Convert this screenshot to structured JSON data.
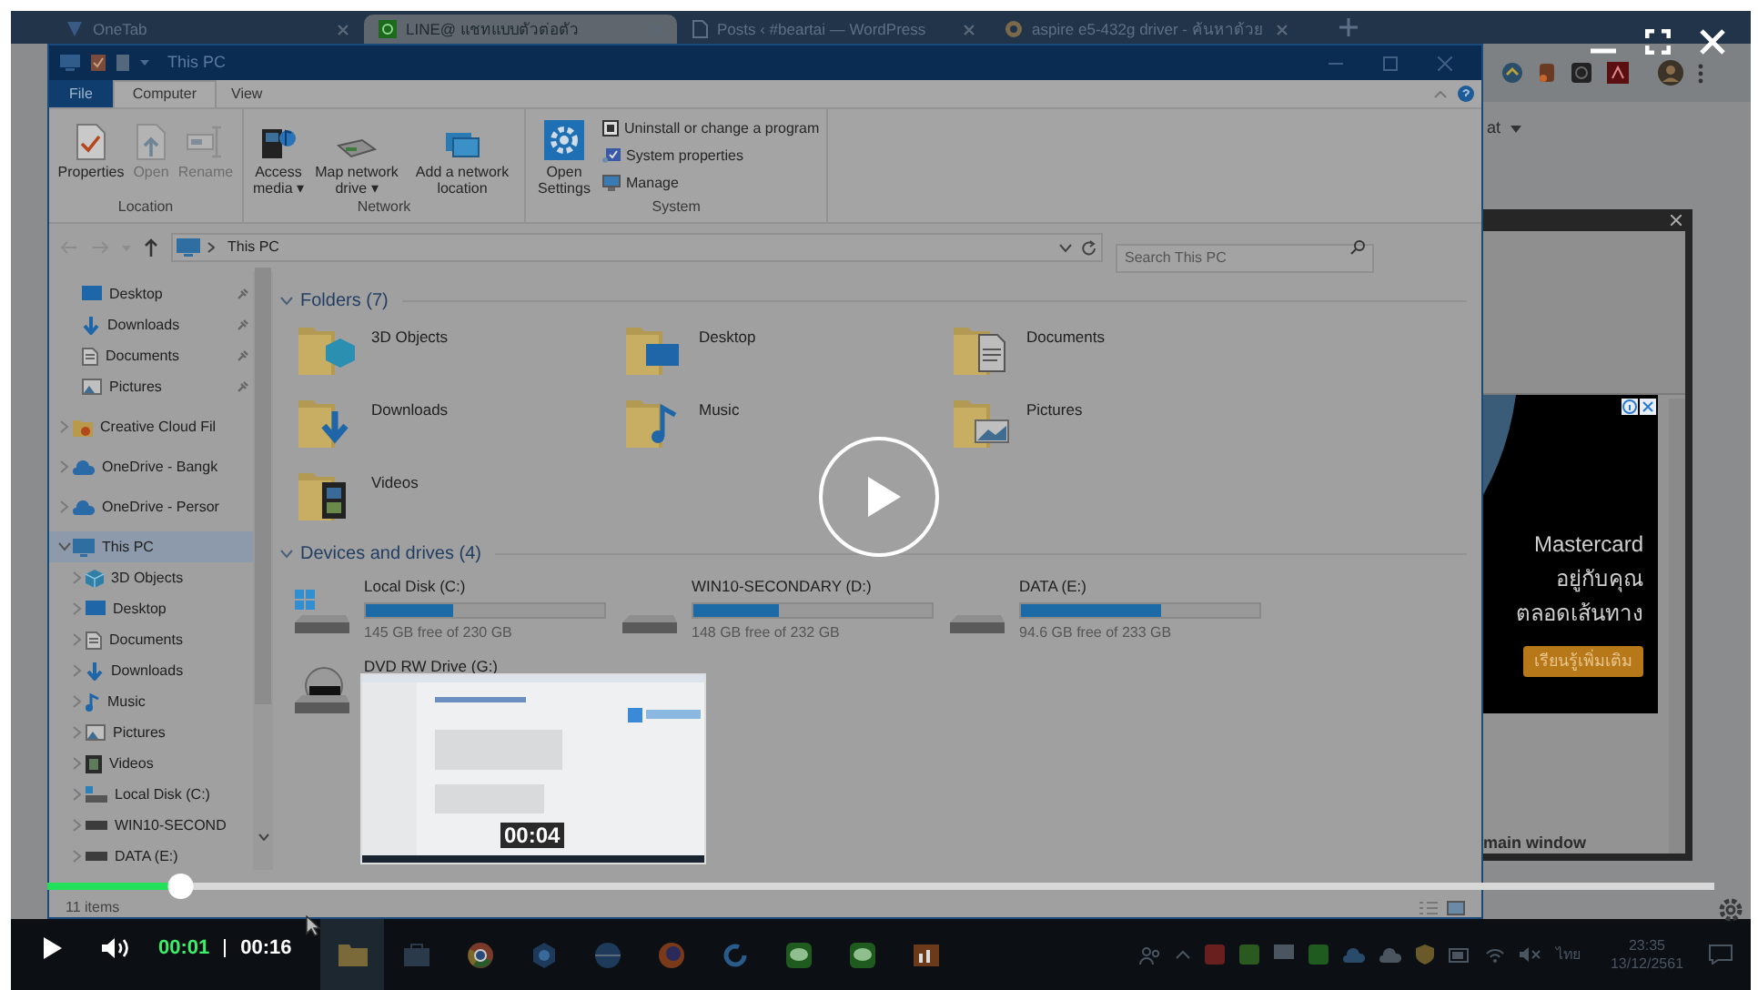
{
  "browser": {
    "tabs": [
      {
        "label": "OneTab",
        "selected": false
      },
      {
        "label": "LINE@ แชทแบบตัวต่อตัว",
        "selected": true
      },
      {
        "label": "Posts ‹ #beartai — WordPress",
        "selected": false
      },
      {
        "label": "aspire e5-432g driver - ค้นหาด้วย",
        "selected": false
      }
    ],
    "page_text": "at"
  },
  "explorer": {
    "title": "This PC",
    "ribbon_tabs": [
      {
        "label": "File",
        "kind": "file",
        "selected": false
      },
      {
        "label": "Computer",
        "kind": "tab",
        "selected": true
      },
      {
        "label": "View",
        "kind": "tab",
        "selected": false
      }
    ],
    "ribbon_groups": [
      {
        "label": "Location",
        "commands": [
          {
            "label": "Properties",
            "kind": "properties",
            "disabled": false
          },
          {
            "label": "Open",
            "kind": "open",
            "disabled": true
          },
          {
            "label": "Rename",
            "kind": "rename",
            "disabled": true
          }
        ]
      },
      {
        "label": "Network",
        "commands": [
          {
            "label": "Access media ▾",
            "kind": "media",
            "disabled": false
          },
          {
            "label": "Map network drive ▾",
            "kind": "netdrive",
            "disabled": false
          },
          {
            "label": "Add a network location",
            "kind": "netloc",
            "disabled": false
          }
        ]
      },
      {
        "label": "System",
        "commands": [
          {
            "label": "Open Settings",
            "kind": "settings",
            "disabled": false
          }
        ],
        "small_commands": [
          {
            "label": "Uninstall or change a program",
            "kind": "uninstall"
          },
          {
            "label": "System properties",
            "kind": "sysprops"
          },
          {
            "label": "Manage",
            "kind": "manage"
          }
        ]
      }
    ],
    "address": "This PC",
    "search": {
      "placeholder": "Search This PC"
    },
    "nav": [
      {
        "label": "Desktop",
        "kind": "desktop",
        "pinned": true
      },
      {
        "label": "Downloads",
        "kind": "download",
        "pinned": true
      },
      {
        "label": "Documents",
        "kind": "document",
        "pinned": true
      },
      {
        "label": "Pictures",
        "kind": "picture",
        "pinned": true
      },
      {
        "label": "Creative Cloud Fil",
        "kind": "cc",
        "expanded": false,
        "selected": false
      },
      {
        "label": "OneDrive - Bangk",
        "kind": "cloud",
        "expanded": false,
        "selected": false
      },
      {
        "label": "OneDrive - Persor",
        "kind": "cloud",
        "expanded": false,
        "selected": false
      },
      {
        "label": "This PC",
        "kind": "pc",
        "expanded": true,
        "selected": true,
        "children": [
          {
            "label": "3D Objects",
            "kind": "cube",
            "expanded": false,
            "selected": false
          },
          {
            "label": "Desktop",
            "kind": "desktop",
            "expanded": false,
            "selected": false
          },
          {
            "label": "Documents",
            "kind": "document",
            "expanded": false,
            "selected": false
          },
          {
            "label": "Downloads",
            "kind": "download",
            "expanded": false,
            "selected": false
          },
          {
            "label": "Music",
            "kind": "music",
            "expanded": false,
            "selected": false
          },
          {
            "label": "Pictures",
            "kind": "picture",
            "expanded": false,
            "selected": false
          },
          {
            "label": "Videos",
            "kind": "video",
            "expanded": false,
            "selected": false
          },
          {
            "label": "Local Disk (C:)",
            "kind": "windrive",
            "expanded": false,
            "selected": false
          },
          {
            "label": "WIN10-SECOND",
            "kind": "drive",
            "expanded": false,
            "selected": false
          },
          {
            "label": "DATA (E:)",
            "kind": "drive",
            "expanded": false,
            "selected": false
          }
        ]
      }
    ],
    "folders": {
      "title": "Folders (7)",
      "expanded": true,
      "items": [
        {
          "label": "3D Objects",
          "kind": "cube"
        },
        {
          "label": "Desktop",
          "kind": "desktop"
        },
        {
          "label": "Documents",
          "kind": "document"
        },
        {
          "label": "Downloads",
          "kind": "download"
        },
        {
          "label": "Music",
          "kind": "music"
        },
        {
          "label": "Pictures",
          "kind": "picture"
        },
        {
          "label": "Videos",
          "kind": "video"
        }
      ]
    },
    "drives": {
      "title": "Devices and drives (4)",
      "expanded": true,
      "items": [
        {
          "label": "Local Disk (C:)",
          "kind": "windrive",
          "level": 0.37,
          "free": "145 GB free of 230 GB"
        },
        {
          "label": "WIN10-SECONDARY (D:)",
          "kind": "drive",
          "level": 0.36,
          "free": "148 GB free of 232 GB"
        },
        {
          "label": "DATA (E:)",
          "kind": "drive",
          "level": 0.59,
          "free": "94.6 GB free of 233 GB"
        },
        {
          "label": "DVD RW Drive (G:)",
          "kind": "dvd"
        }
      ]
    },
    "status": "11 items"
  },
  "ad": {
    "lines": [
      "Mastercard",
      "อยู่กับคุณ",
      "ตลอดเส้นทาง"
    ],
    "button": "เรียนรู้เพิ่มเติม",
    "caption": "main window"
  },
  "player": {
    "level": 0.08,
    "current": "00:01",
    "duration": "00:16",
    "preview_time": "00:04",
    "playing": false
  },
  "taskbar": {
    "language": "ไทย",
    "time": "23:35",
    "date": "13/12/2561"
  }
}
